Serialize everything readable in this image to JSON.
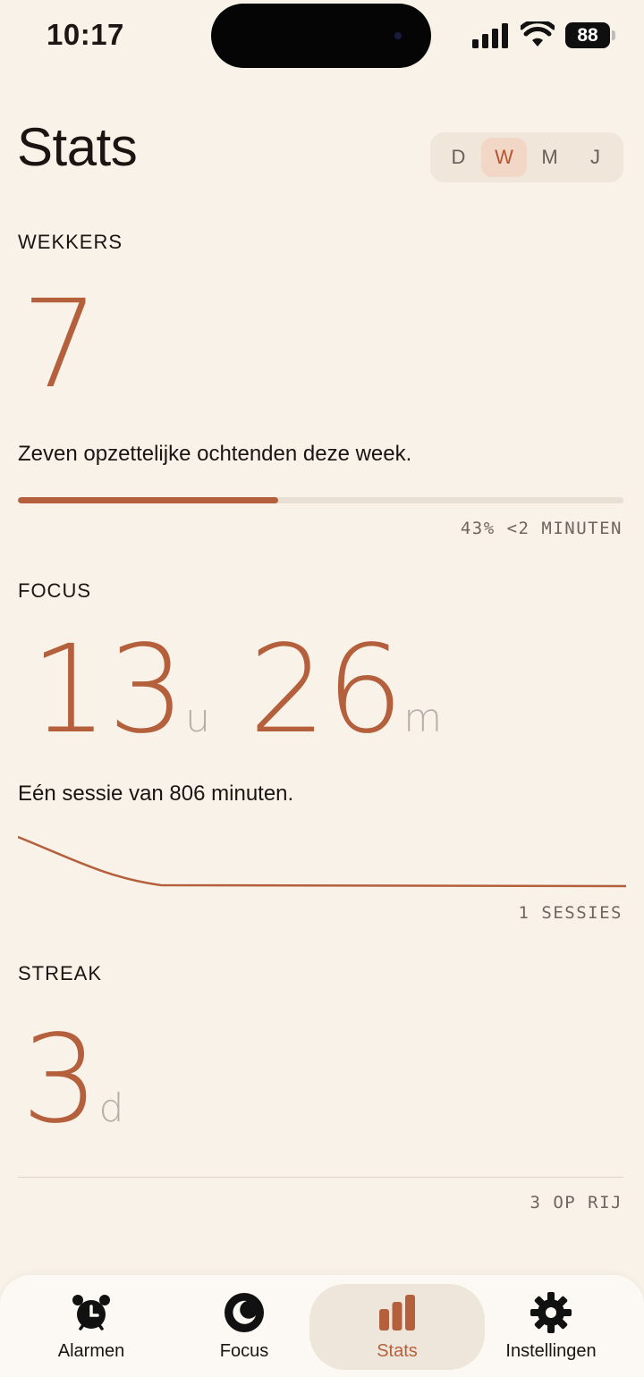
{
  "status_bar": {
    "time": "10:17",
    "battery": "88"
  },
  "header": {
    "title": "Stats",
    "periods": [
      "D",
      "W",
      "M",
      "J"
    ],
    "selected_period": "W"
  },
  "wekkers": {
    "label": "WEKKERS",
    "value": "7",
    "description": "Zeven opzettelijke ochtenden deze week.",
    "progress_fraction": 0.43,
    "caption": "43% <2 MINUTEN"
  },
  "focus": {
    "label": "FOCUS",
    "hours": "13",
    "hours_unit": "u",
    "minutes": "26",
    "minutes_unit": "m",
    "description": "Eén sessie van 806 minuten.",
    "caption": "1 SESSIES"
  },
  "streak": {
    "label": "STREAK",
    "value": "3",
    "unit": "d",
    "caption": "3 OP RIJ"
  },
  "colors": {
    "accent": "#b5603d",
    "background": "#f9f2e9",
    "muted": "#b6aea8"
  },
  "tab_bar": {
    "tabs": [
      {
        "label": "Alarmen",
        "icon": "alarm-clock-icon"
      },
      {
        "label": "Focus",
        "icon": "moon-icon"
      },
      {
        "label": "Stats",
        "icon": "bar-chart-icon"
      },
      {
        "label": "Instellingen",
        "icon": "gear-icon"
      }
    ],
    "active": "Stats"
  }
}
